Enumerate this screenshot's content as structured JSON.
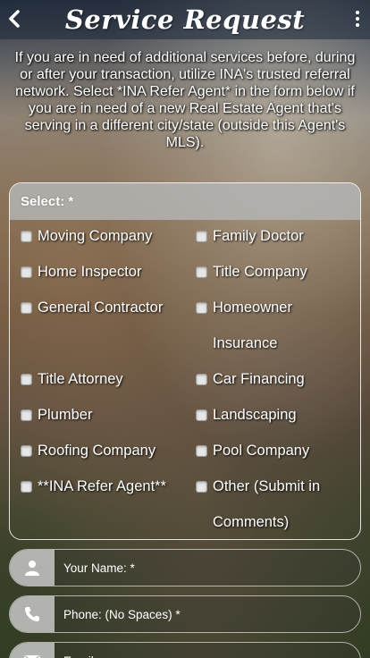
{
  "header": {
    "title": "Service Request",
    "back_icon": "chevron-left-icon",
    "menu_icon": "vertical-dots-icon"
  },
  "intro_text": "If you are in need of additional services before, during or after your transaction, utilize INA's trusted referral network. Select *INA Refer Agent* in the form below if you are in need of a new Real Estate Agent that's serving in a different city/state (outside this Agent's MLS).",
  "select": {
    "label": "Select: *",
    "left_options": [
      "Moving Company",
      "Home Inspector",
      "General Contractor",
      "Title Attorney",
      "Plumber",
      "Roofing Company",
      "**INA Refer Agent**"
    ],
    "right_options": [
      "Family Doctor",
      "Title Company",
      "Homeowner Insurance",
      "Car Financing",
      "Landscaping",
      "Pool Company",
      "Other (Submit in Comments)"
    ]
  },
  "fields": {
    "name_placeholder": "Your Name: *",
    "phone_placeholder": "Phone: (No Spaces) *",
    "email_placeholder": "Email:"
  }
}
